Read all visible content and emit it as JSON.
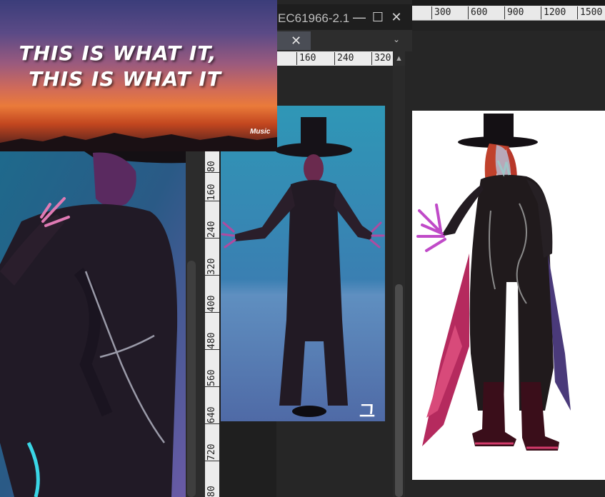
{
  "mid_window": {
    "title": "EC61966-2.1",
    "minimize": "—",
    "maximize": "☐",
    "close": "✕",
    "tab_close": "✕",
    "tab_menu": "⌄",
    "h_ruler": [
      "160",
      "240",
      "320"
    ],
    "v_ruler": [
      "80",
      "160",
      "240",
      "320",
      "400",
      "480",
      "560",
      "640",
      "720",
      "80"
    ],
    "scroll_up": "▲",
    "watermark": "그"
  },
  "right_window": {
    "ruler": [
      "300",
      "600",
      "900",
      "1200",
      "1500"
    ]
  },
  "sunset": {
    "lyric_line1": "THIS IS WHAT IT,",
    "lyric_line2": "THIS IS WHAT IT",
    "logo_text": "Music"
  },
  "colors": {
    "app_bg": "#1f1f1f",
    "ruler_bg": "#ececec",
    "tab_active": "#4a4d55",
    "canvas_white": "#ffffff"
  }
}
